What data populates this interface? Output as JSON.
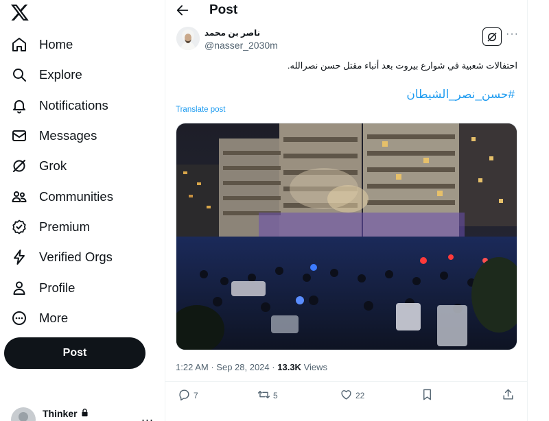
{
  "sidebar": {
    "logo_icon": "x-logo-icon",
    "items": [
      {
        "label": "Home",
        "icon": "home-icon"
      },
      {
        "label": "Explore",
        "icon": "search-icon"
      },
      {
        "label": "Notifications",
        "icon": "bell-icon"
      },
      {
        "label": "Messages",
        "icon": "envelope-icon"
      },
      {
        "label": "Grok",
        "icon": "grok-icon"
      },
      {
        "label": "Communities",
        "icon": "communities-icon"
      },
      {
        "label": "Premium",
        "icon": "verified-badge-icon"
      },
      {
        "label": "Verified Orgs",
        "icon": "lightning-icon"
      },
      {
        "label": "Profile",
        "icon": "person-icon"
      },
      {
        "label": "More",
        "icon": "more-circle-icon"
      }
    ],
    "post_label": "Post",
    "account": {
      "name": "Thinker",
      "more": "..."
    }
  },
  "header": {
    "title": "Post"
  },
  "tweet": {
    "author_name": "ناصر بن محمد",
    "author_handle": "@nasser_2030m",
    "text": "احتفالات شعبية في شوارع بيروت بعد أنباء مقتل حسن نصرالله.",
    "hashtag": "#حسن_نصر_الشيطان",
    "translate_label": "Translate post",
    "time": "1:22 AM",
    "date": "Sep 28, 2024",
    "views_count": "13.3K",
    "views_label": "Views",
    "replies": "7",
    "reposts": "5",
    "likes": "22"
  },
  "colors": {
    "accent": "#1d9bf0",
    "text": "#0f1419",
    "muted": "#536471",
    "divider": "#eff3f4"
  }
}
